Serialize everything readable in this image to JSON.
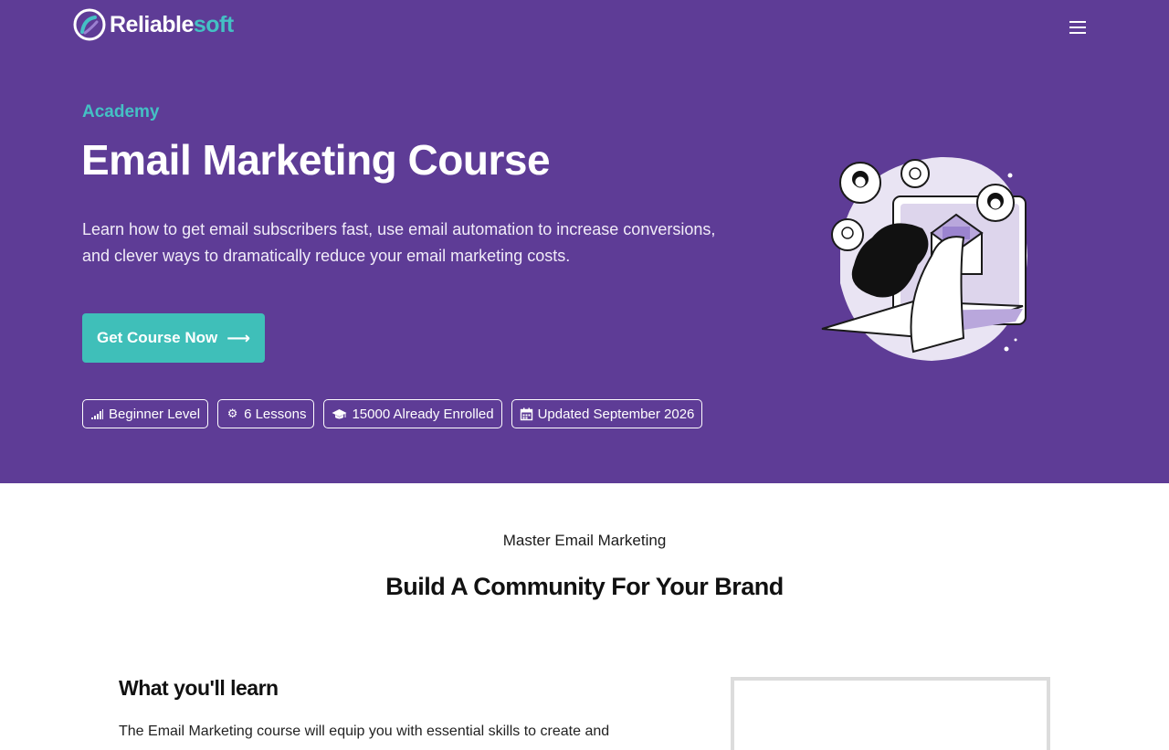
{
  "brand": {
    "name_part1": "Reliable",
    "name_part2": "soft",
    "accent": "#44c0c4",
    "hero_bg": "#5e3c96"
  },
  "header": {
    "menu_icon": "hamburger-menu-icon"
  },
  "hero": {
    "eyebrow": "Academy",
    "title": "Email Marketing Course",
    "lead": "Learn how to get email subscribers fast, use email automation to increase conversions, and clever ways to dramatically reduce your email marketing costs.",
    "cta_label": "Get Course Now",
    "cta_icon": "arrow-right-icon",
    "badges": [
      {
        "icon": "signal-bars-icon",
        "label": "Beginner Level"
      },
      {
        "icon": "gear-icon",
        "label": "6 Lessons"
      },
      {
        "icon": "graduation-cap-icon",
        "label": "15000 Already Enrolled"
      },
      {
        "icon": "calendar-icon",
        "label": "Updated September 2026"
      }
    ]
  },
  "section": {
    "kicker": "Master Email Marketing",
    "heading": "Build A Community For Your Brand"
  },
  "learn": {
    "heading": "What you'll learn",
    "intro_partial": "The Email Marketing course will equip you with essential skills to create and"
  }
}
